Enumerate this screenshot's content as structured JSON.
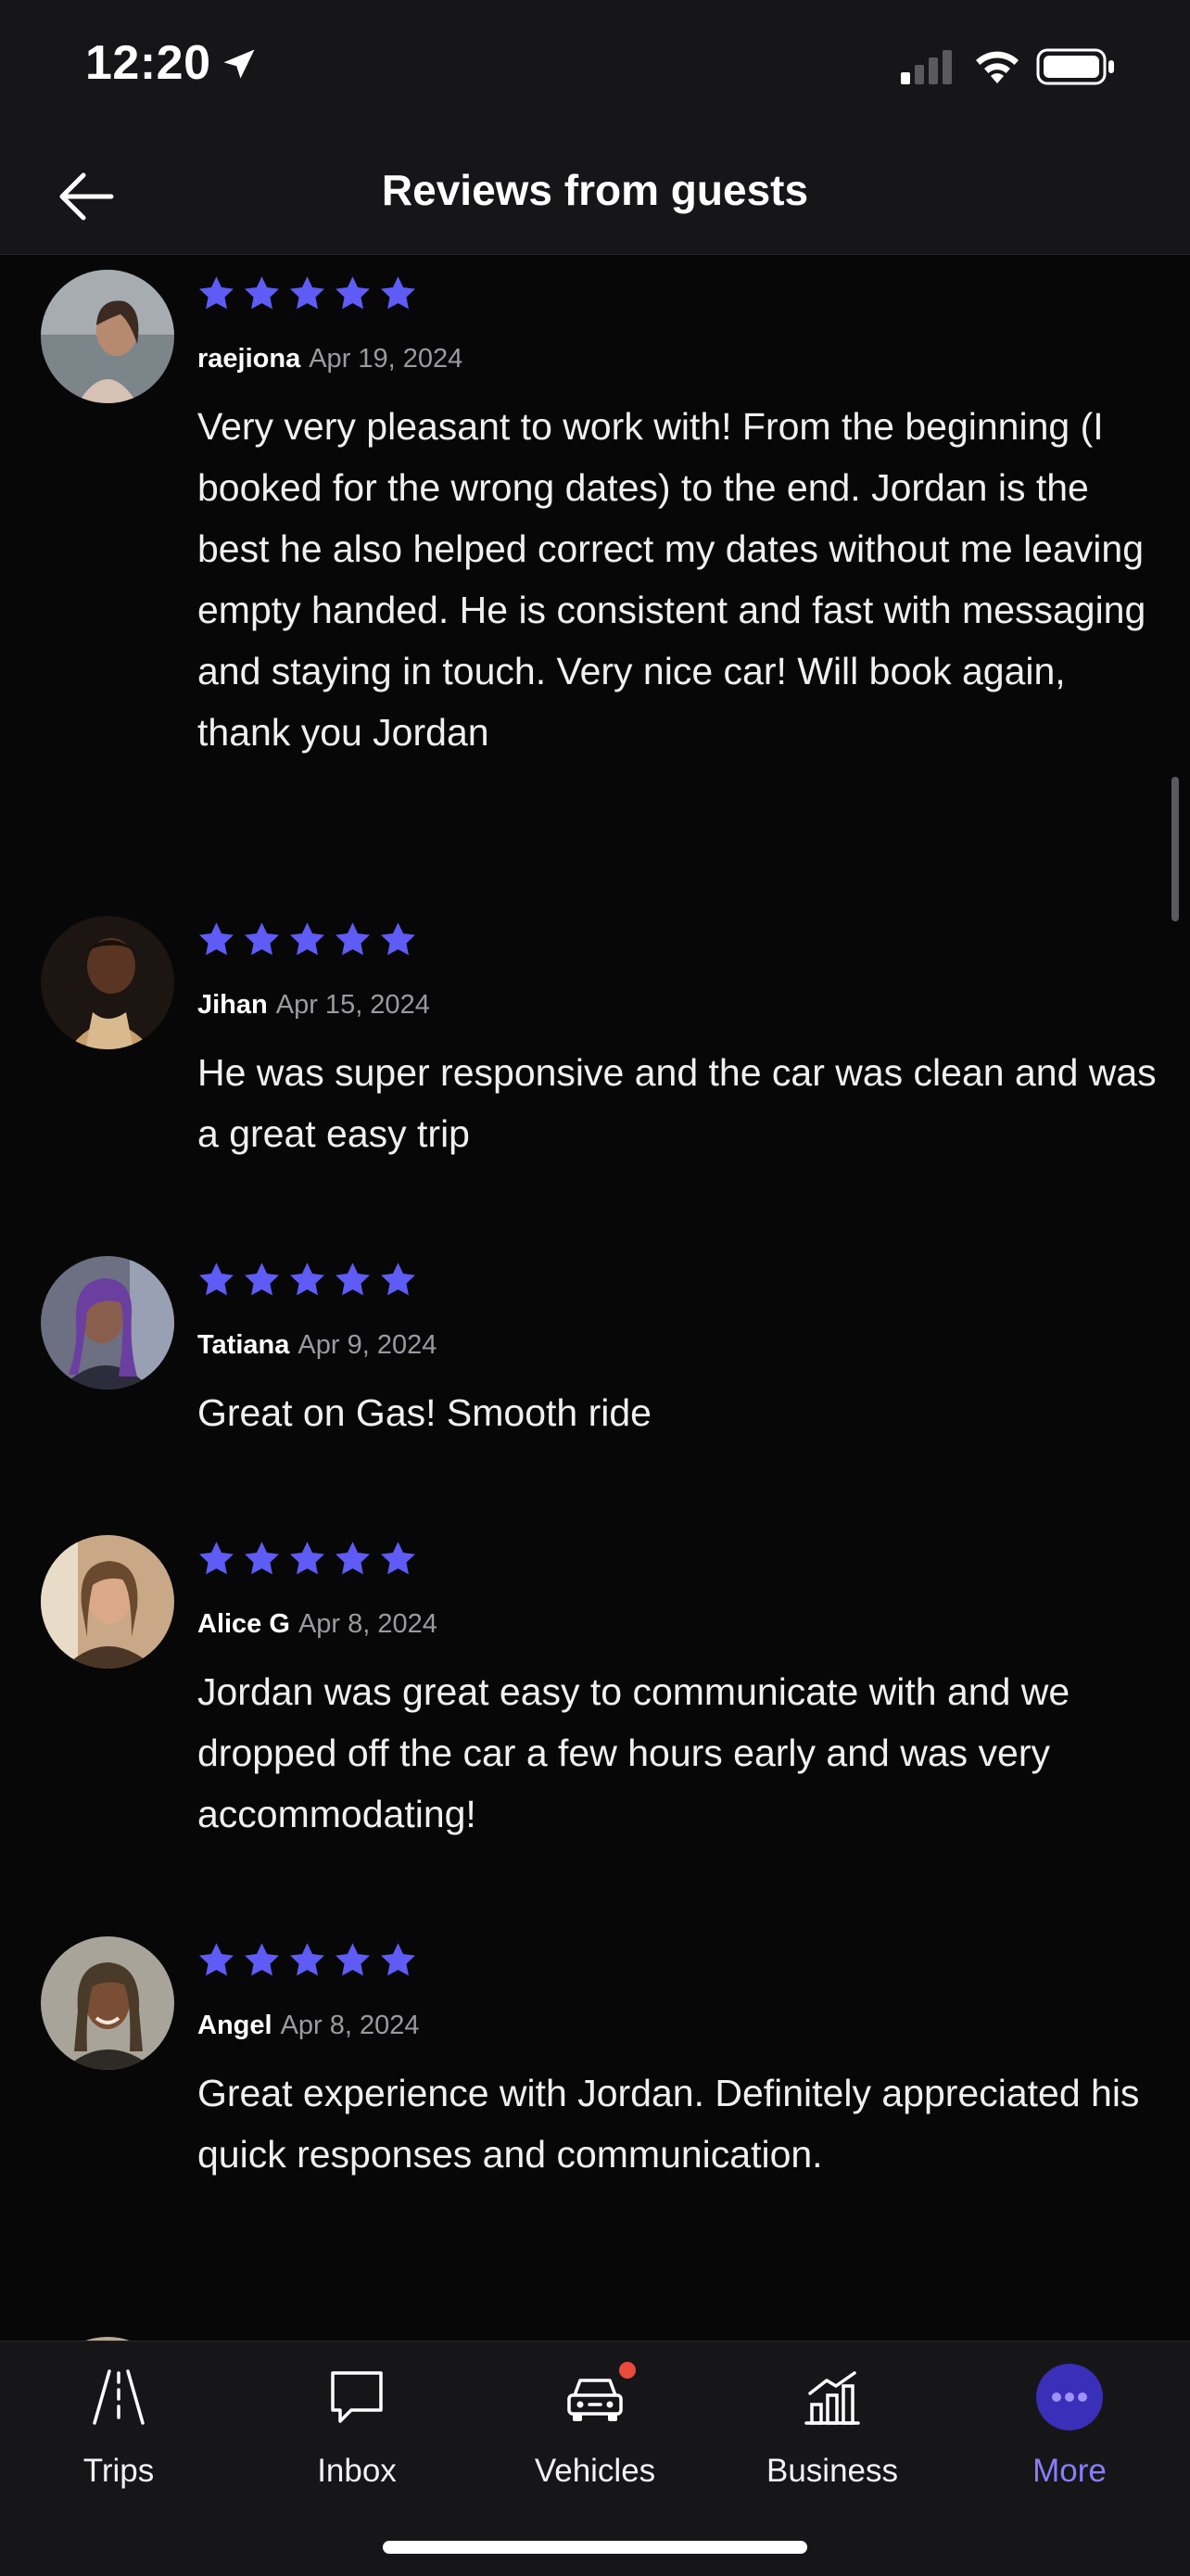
{
  "status_bar": {
    "time": "12:20"
  },
  "header": {
    "title": "Reviews from guests"
  },
  "colors": {
    "accent": "#5e5cf5",
    "background": "#070708",
    "bar": "#161618",
    "active_tab": "#8a7cff",
    "badge": "#ea4a3c"
  },
  "reviews": [
    {
      "rating": 5,
      "name": "raejiona",
      "date": "Apr 19, 2024",
      "text": "Very very pleasant to work with! From the beginning (I booked for the wrong dates) to the end. Jordan is the best he also helped correct my dates without me leaving empty handed. He is consistent and fast with messaging and staying in touch. Very nice car! Will book again, thank you Jordan"
    },
    {
      "rating": 5,
      "name": "Jihan",
      "date": "Apr 15, 2024",
      "text": "He was super responsive and the car was clean and was a great easy trip"
    },
    {
      "rating": 5,
      "name": "Tatiana",
      "date": "Apr 9, 2024",
      "text": "Great on Gas! Smooth ride"
    },
    {
      "rating": 5,
      "name": "Alice G",
      "date": "Apr 8, 2024",
      "text": "Jordan was great easy to communicate with and we dropped off the car a few hours early and was very accommodating!"
    },
    {
      "rating": 5,
      "name": "Angel",
      "date": "Apr 8, 2024",
      "text": "Great experience with Jordan. Definitely appreciated his quick responses and communication."
    }
  ],
  "tabs": [
    {
      "label": "Trips",
      "icon": "road-icon",
      "active": false
    },
    {
      "label": "Inbox",
      "icon": "chat-bubble-icon",
      "active": false
    },
    {
      "label": "Vehicles",
      "icon": "car-icon",
      "active": false,
      "badge": true
    },
    {
      "label": "Business",
      "icon": "bar-chart-icon",
      "active": false
    },
    {
      "label": "More",
      "icon": "more-dots-icon",
      "active": true
    }
  ]
}
